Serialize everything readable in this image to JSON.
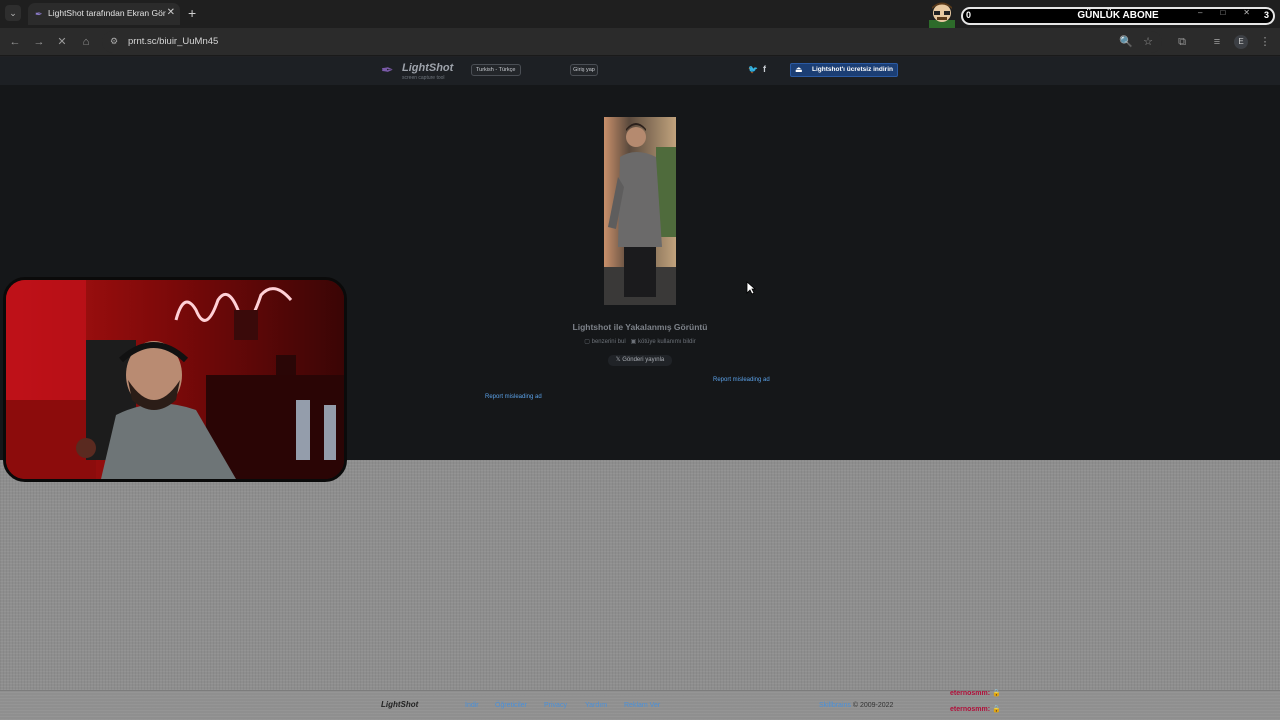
{
  "browser": {
    "tab": {
      "title": "LightShot tarafından Ekran Görüntüsü"
    },
    "url": "prnt.sc/biuir_UuMn45"
  },
  "sub_widget": {
    "count": "0",
    "title": "GÜNLÜK ABONE",
    "goal": "3"
  },
  "site": {
    "logo_text": "LightShot",
    "logo_sub": "screen capture tool",
    "language": "Turkish - Türkçe",
    "login": "Giriş yap",
    "download": "Lightshot'ı ücretsiz indirin"
  },
  "content": {
    "caption": "Lightshot ile Yakalanmış Görüntü",
    "find_similar": "benzerini bul",
    "report_abuse": "kötüye kullanımı bildir",
    "post_button": "Gönderi yayınla",
    "report_ad_1": "Report misleading ad",
    "report_ad_2": "Report misleading ad"
  },
  "footer": {
    "logo": "LightShot",
    "links": [
      "İndir",
      "Öğreticiler",
      "Privacy",
      "Yardım",
      "Reklam Ver"
    ],
    "brand": "Skillbrains",
    "copyright": "© 2009-2022"
  },
  "chat_overlay": [
    "eternosmm: 🔒",
    "eternosmm: 🔒"
  ],
  "colors": {
    "download_button": "#1b3e74",
    "link": "#5aa0e6",
    "webcam_red": "#c4111b"
  }
}
